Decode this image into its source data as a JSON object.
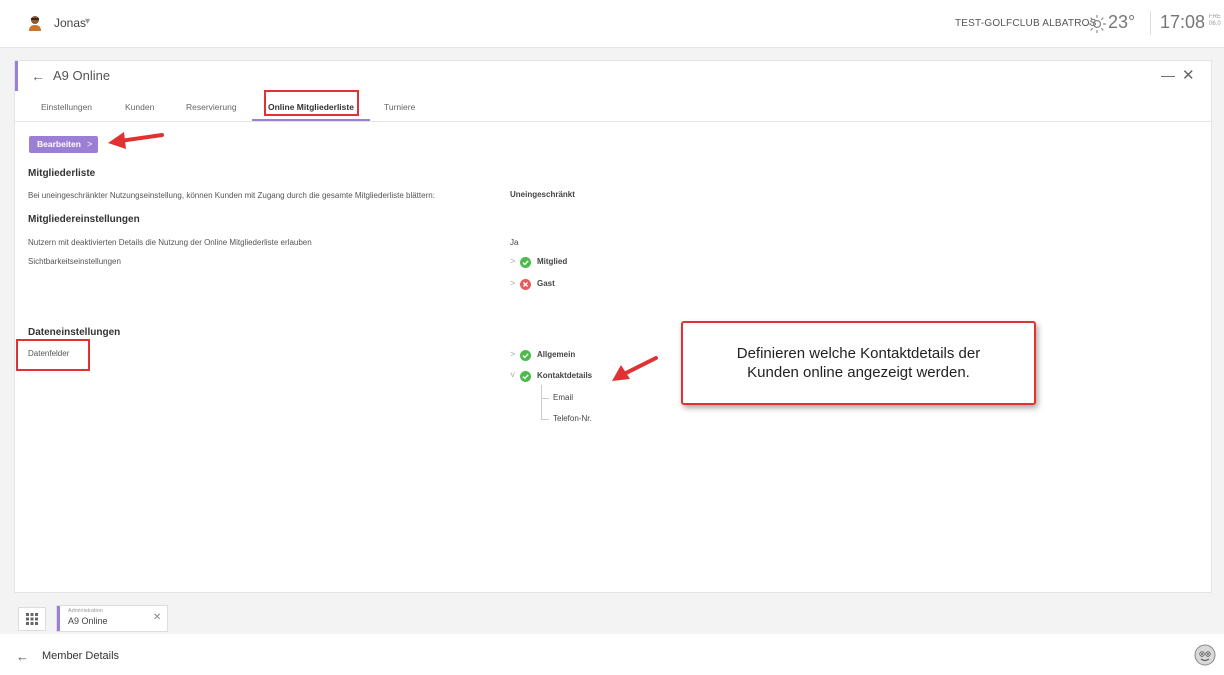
{
  "topbar": {
    "user_name": "Jonas",
    "user_caret": "▾",
    "club_name": "TEST-GOLFCLUB ALBATROS",
    "temperature": "23°",
    "time": "17:08",
    "day": "FRE 06.0"
  },
  "panel": {
    "back_icon": "←",
    "title": "A9 Online",
    "minimize_icon": "—",
    "close_icon": "✕",
    "tabs": [
      {
        "label": "Einstellungen"
      },
      {
        "label": "Kunden"
      },
      {
        "label": "Reservierung"
      },
      {
        "label": "Online Mitgliederliste"
      },
      {
        "label": "Turniere"
      }
    ],
    "edit_button": "Bearbeiten",
    "edit_chevron": ">"
  },
  "sections": {
    "mitgliederliste": {
      "heading": "Mitgliederliste",
      "label": "Bei uneingeschränkter Nutzungseinstellung, können Kunden mit Zugang durch die gesamte Mitgliederliste blättern:",
      "value": "Uneingeschränkt"
    },
    "mitgliedereinstellungen": {
      "heading": "Mitgliedereinstellungen",
      "deaktivierte_label": "Nutzern mit deaktivierten Details die Nutzung der Online Mitgliederliste erlauben",
      "deaktivierte_value": "Ja",
      "sichtbarkeit_label": "Sichtbarkeitseinstellungen",
      "sichtbarkeit_items": [
        {
          "label": "Mitglied",
          "status": "check",
          "arrow": ">"
        },
        {
          "label": "Gast",
          "status": "cross",
          "arrow": ">"
        }
      ]
    },
    "dateneinstellungen": {
      "heading": "Dateneinstellungen",
      "datenfelder_label": "Datenfelder",
      "items": [
        {
          "label": "Allgemein",
          "status": "check",
          "arrow": ">"
        },
        {
          "label": "Kontaktdetails",
          "status": "check",
          "arrow": "˅"
        }
      ],
      "sub_items": [
        "Email",
        "Telefon-Nr."
      ]
    }
  },
  "callout": {
    "text_line1": "Definieren welche Kontaktdetails der",
    "text_line2": "Kunden online angezeigt werden."
  },
  "taskbar": {
    "task_small": "Administration",
    "task_name": "A9 Online",
    "task_close": "✕"
  },
  "footer": {
    "back_icon": "←",
    "title": "Member Details"
  },
  "colors": {
    "accent": "#9b7fd4",
    "highlight": "#e03232",
    "check": "#4cbb4c",
    "cross": "#e35d5d"
  }
}
